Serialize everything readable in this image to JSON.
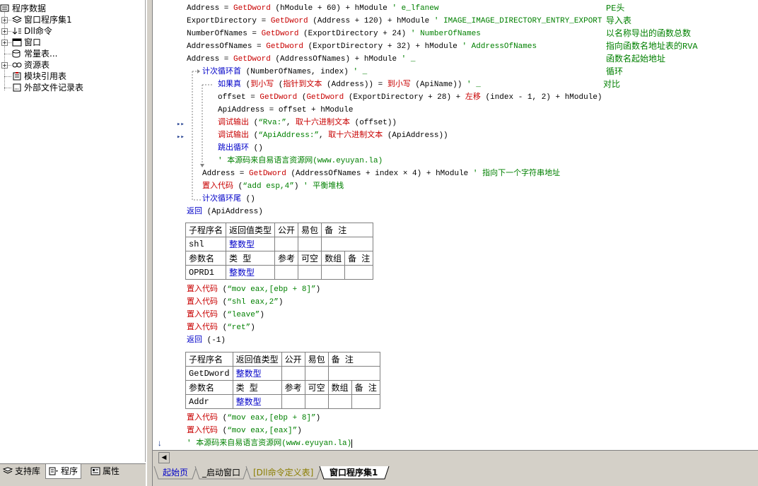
{
  "tree": {
    "root_label": "程序数据",
    "items": [
      {
        "label": "窗口程序集1",
        "expander": "+"
      },
      {
        "label": "Dll命令",
        "expander": "+"
      },
      {
        "label": "窗口",
        "expander": "+"
      },
      {
        "label": "常量表...",
        "expander": ""
      },
      {
        "label": "资源表",
        "expander": "+"
      },
      {
        "label": "模块引用表",
        "expander": ""
      },
      {
        "label": "外部文件记录表",
        "expander": ""
      }
    ]
  },
  "left_tabs": [
    "支持库",
    "程序",
    "属性"
  ],
  "code": {
    "lines": [
      {
        "t": "Address = GetDword (hModule + 60) + hModule ' e_lfanew"
      },
      {
        "t": "ExportDirectory = GetDword (Address + 120) + hModule ' IMAGE_IMAGE_DIRECTORY_ENTRY_EXPORT"
      },
      {
        "t": "NumberOfNames = GetDword (ExportDirectory + 24) ' NumberOfNames"
      },
      {
        "t": "AddressOfNames = GetDword (ExportDirectory + 32) + hModule ' AddressOfNames"
      },
      {
        "t": "Address = GetDword (AddressOfNames) + hModule ' _"
      },
      {
        "t": "计次循环首 (NumberOfNames, index) ' _"
      },
      {
        "t": "如果真 (到小写 (指针到文本 (Address)) = 到小写 (ApiName)) ' _"
      },
      {
        "t": "offset = GetDword (GetDword (ExportDirectory + 28) + 左移 (index - 1, 2) + hModule)"
      },
      {
        "t": "ApiAddress = offset + hModule"
      },
      {
        "t": "调试输出 (“Rva:”, 取十六进制文本 (offset))"
      },
      {
        "t": "调试输出 (“ApiAddress:”, 取十六进制文本 (ApiAddress))"
      },
      {
        "t": "跳出循环 ()"
      },
      {
        "t": "' 本源码来自易语言资源网(www.eyuyan.la)"
      },
      {
        "t": "Address = GetDword (AddressOfNames + index × 4) + hModule ' 指向下一个字符串地址"
      },
      {
        "t": "置入代码 (“add esp,4”) ' 平衡堆栈"
      },
      {
        "t": "计次循环尾 ()"
      },
      {
        "t": "返回 (ApiAddress)"
      }
    ],
    "notes": [
      "PE头",
      "导入表",
      "以名称导出的函数总数",
      "指向函数名地址表的RVA",
      "函数名起始地址",
      "循环",
      "对比"
    ],
    "sub1": {
      "header": [
        "子程序名",
        "返回值类型",
        "公开",
        "易包",
        "备 注"
      ],
      "row": [
        "shl",
        "整数型",
        "",
        "",
        ""
      ],
      "param_header": [
        "参数名",
        "类 型",
        "参考",
        "可空",
        "数组",
        "备 注"
      ],
      "param_row": [
        "OPRD1",
        "整数型",
        "",
        "",
        "",
        ""
      ]
    },
    "sub1_body": [
      "置入代码 (“mov eax,[ebp + 8]”)",
      "置入代码 (“shl eax,2”)",
      "置入代码 (“leave”)",
      "置入代码 (“ret”)",
      "返回 (-1)"
    ],
    "sub2": {
      "header": [
        "子程序名",
        "返回值类型",
        "公开",
        "易包",
        "备 注"
      ],
      "row": [
        "GetDword",
        "整数型",
        "",
        "",
        ""
      ],
      "param_header": [
        "参数名",
        "类 型",
        "参考",
        "可空",
        "数组",
        "备 注"
      ],
      "param_row": [
        "Addr",
        "整数型",
        "",
        "",
        "",
        ""
      ]
    },
    "sub2_body": [
      "置入代码 (“mov eax,[ebp + 8]”)",
      "置入代码 (“mov eax,[eax]”)",
      "' 本源码来自易语言资源网(www.eyuyan.la)"
    ]
  },
  "editor_tabs": [
    "起始页",
    "_启动窗口",
    "[Dll命令定义表]",
    "窗口程序集1"
  ],
  "colors": {
    "keyword": "#0000c8",
    "function": "#c80000",
    "comment": "#008000",
    "chrome": "#d4d0c8"
  }
}
